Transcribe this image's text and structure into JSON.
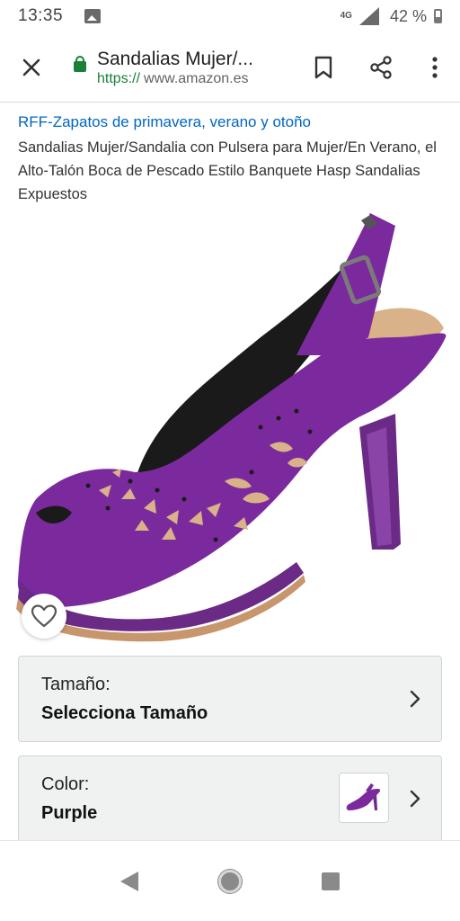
{
  "status_bar": {
    "time": "13:35",
    "network": "4G",
    "battery": "42 %",
    "icons": [
      "image-icon",
      "signal-icon",
      "battery-icon"
    ]
  },
  "toolbar": {
    "page_title": "Sandalias Mujer/...",
    "url_scheme": "https://",
    "url_host": "www.amazon.es",
    "icons": [
      "close-icon",
      "lock-icon",
      "bookmark-icon",
      "share-icon",
      "more-vert-icon"
    ]
  },
  "product": {
    "brand": "RFF-Zapatos de primavera, verano y otoño",
    "title": "Sandalias Mujer/Sandalia con Pulsera para Mujer/En Verano, el Alto-Talón Boca de Pescado Estilo Banquete Hasp Sandalias Expuestos",
    "image_icon": "purple-high-heel-sandal-image",
    "wishlist_icon": "heart-icon"
  },
  "options": {
    "size": {
      "label": "Tamaño:",
      "value": "Selecciona Tamaño"
    },
    "color": {
      "label": "Color:",
      "value": "Purple"
    }
  },
  "colors": {
    "brand_link": "#0066c0",
    "secure_green": "#188038",
    "shoe_purple": "#7b2a9e"
  },
  "nav_bar": {
    "icons": [
      "back-icon",
      "home-icon",
      "recents-icon"
    ]
  }
}
